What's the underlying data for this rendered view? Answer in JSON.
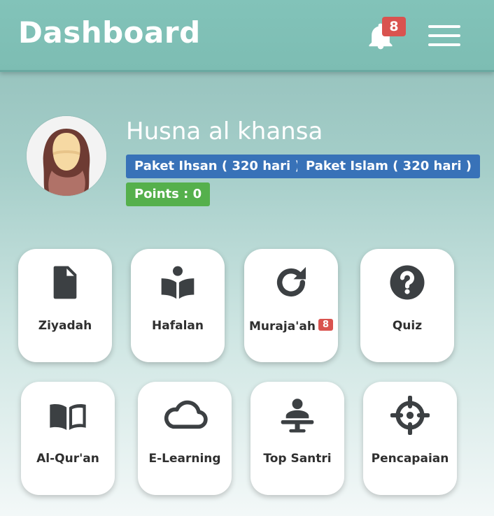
{
  "header": {
    "title": "Dashboard",
    "notification_count": "8",
    "icons": [
      "bell-icon",
      "hamburger-menu-icon"
    ]
  },
  "profile": {
    "name": "Husna al khansa",
    "packages": [
      "Paket Ihsan ( 320 hari )",
      "Paket Islam ( 320 hari )"
    ],
    "points": "Points : 0"
  },
  "menu": [
    {
      "label": "Ziyadah",
      "icon": "file-icon"
    },
    {
      "label": "Hafalan",
      "icon": "book-reader-icon"
    },
    {
      "label": "Muraja'ah",
      "icon": "refresh-icon",
      "badge": "8"
    },
    {
      "label": "Quiz",
      "icon": "question-circle-icon"
    },
    {
      "label": "Al-Qur'an",
      "icon": "open-book-icon"
    },
    {
      "label": "E-Learning",
      "icon": "cloud-icon"
    },
    {
      "label": "Top Santri",
      "icon": "podium-person-icon"
    },
    {
      "label": "Pencapaian",
      "icon": "crosshairs-icon"
    }
  ],
  "colors": {
    "header": "#7dbdb3",
    "package_badge": "#3872b8",
    "points_badge": "#55b04c",
    "notification_badge": "#d9534f",
    "icon": "#3c4043"
  }
}
